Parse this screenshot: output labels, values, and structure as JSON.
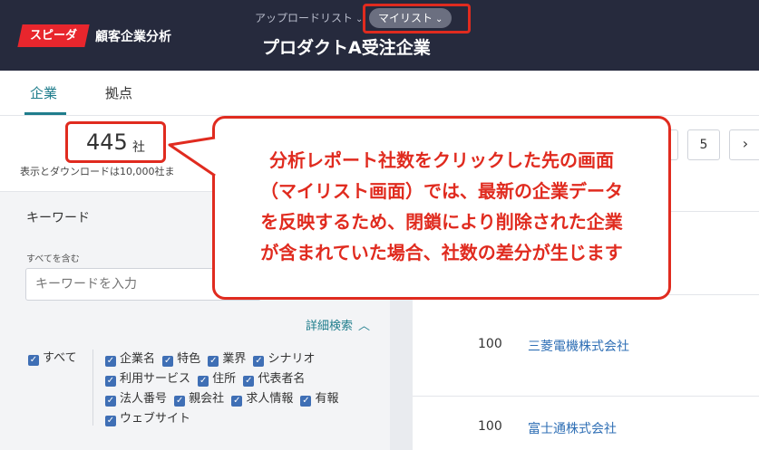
{
  "header": {
    "logo_text": "スピーダ",
    "app_title": "顧客企業分析",
    "upload_list_label": "アップロードリスト",
    "mylist_label": "マイリスト",
    "page_title": "プロダクトA受注企業"
  },
  "tabs": [
    {
      "label": "企業"
    },
    {
      "label": "拠点"
    }
  ],
  "summary": {
    "count": "445",
    "count_unit": "社",
    "download_note": "表示とダウンロードは10,000社ま"
  },
  "filter": {
    "keyword_title": "キーワード",
    "include_all_label": "すべてを含む",
    "keyword_placeholder": "キーワードを入力",
    "advanced_search_label": "詳細検索",
    "all_label": "すべて",
    "options": [
      [
        "企業名",
        "特色",
        "業界",
        "シナリオ"
      ],
      [
        "利用サービス",
        "住所",
        "代表者名"
      ],
      [
        "法人番号",
        "親会社",
        "求人情報",
        "有報"
      ],
      [
        "ウェブサイト"
      ]
    ]
  },
  "pagination": {
    "page_5": "5",
    "next": "›"
  },
  "results": [
    {
      "score": "100",
      "name": "三菱電機株式会社"
    },
    {
      "score": "100",
      "name": "富士通株式会社"
    }
  ],
  "callout": {
    "lines": [
      "分析レポート社数をクリックした先の画面",
      "（マイリスト画面）では、最新の企業データ",
      "を反映するため、閉鎖により削除された企業",
      "が含まれていた場合、社数の差分が生じます"
    ]
  },
  "colors": {
    "header_bg": "#262a3d",
    "accent": "#1f7d8c",
    "annotation_red": "#e02b1f",
    "link": "#2f6fb5"
  }
}
